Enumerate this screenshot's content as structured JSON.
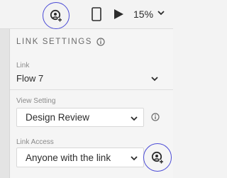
{
  "toolbar": {
    "zoom_value": "15%"
  },
  "panel": {
    "header": "LINK SETTINGS",
    "link": {
      "label": "Link",
      "value": "Flow 7"
    },
    "view_setting": {
      "label": "View Setting",
      "value": "Design Review"
    },
    "link_access": {
      "label": "Link Access",
      "value": "Anyone with the link"
    }
  },
  "colors": {
    "highlight_circle": "#4b4bd6",
    "panel_bg": "#f5f5f5",
    "text": "#2c2c2c"
  }
}
